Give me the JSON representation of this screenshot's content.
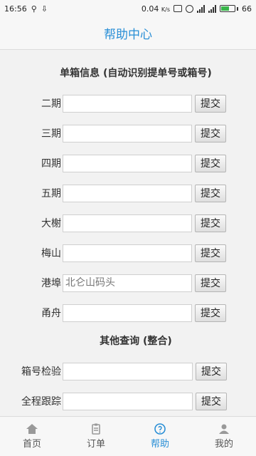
{
  "status_bar": {
    "time": "16:56",
    "speed": "0.04",
    "speed_unit": "K/s",
    "battery": "66"
  },
  "header": {
    "title": "帮助中心"
  },
  "single_box": {
    "title": "单箱信息 (自动识别提单号或箱号)",
    "rows": [
      {
        "label": "二期",
        "value": "",
        "button": "提交"
      },
      {
        "label": "三期",
        "value": "",
        "button": "提交"
      },
      {
        "label": "四期",
        "value": "",
        "button": "提交"
      },
      {
        "label": "五期",
        "value": "",
        "button": "提交"
      },
      {
        "label": "大榭",
        "value": "",
        "button": "提交"
      },
      {
        "label": "梅山",
        "value": "",
        "button": "提交"
      },
      {
        "label": "港埠",
        "value": "",
        "placeholder": "北仑山码头",
        "button": "提交"
      },
      {
        "label": "甬舟",
        "value": "",
        "button": "提交"
      }
    ]
  },
  "other_query": {
    "title": "其他查询 (整合)",
    "rows": [
      {
        "label": "箱号检验",
        "value": "",
        "button": "提交"
      },
      {
        "label": "全程跟踪",
        "value": "",
        "button": "提交"
      }
    ]
  },
  "bottom_nav": {
    "items": [
      {
        "label": "首页",
        "icon": "home-icon"
      },
      {
        "label": "订单",
        "icon": "order-icon"
      },
      {
        "label": "帮助",
        "icon": "help-icon",
        "active": true
      },
      {
        "label": "我的",
        "icon": "user-icon"
      }
    ]
  },
  "colors": {
    "accent": "#2a8fd6"
  }
}
